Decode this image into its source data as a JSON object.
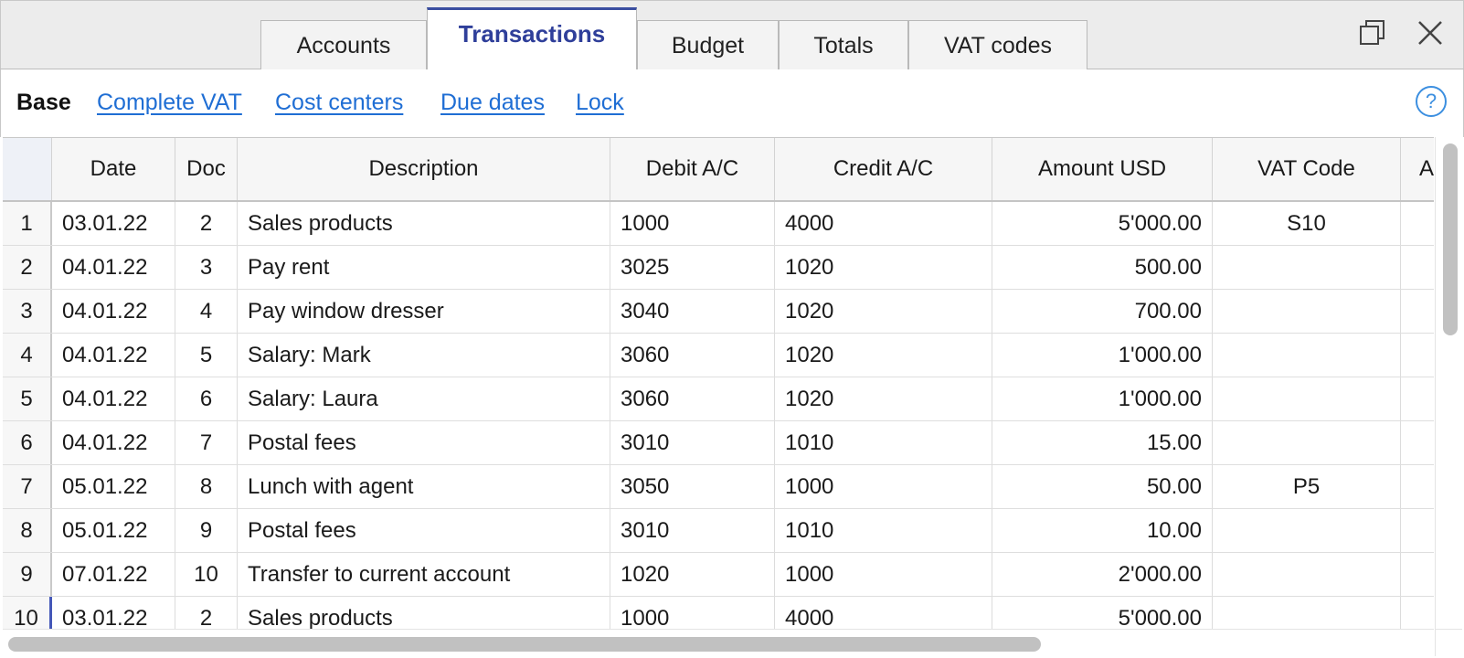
{
  "tabs": [
    {
      "label": "Accounts",
      "active": false
    },
    {
      "label": "Transactions",
      "active": true
    },
    {
      "label": "Budget",
      "active": false
    },
    {
      "label": "Totals",
      "active": false
    },
    {
      "label": "VAT codes",
      "active": false
    }
  ],
  "window_controls": {
    "restore_icon": "restore-window-icon",
    "close_icon": "close-icon"
  },
  "views": {
    "base": "Base",
    "links": [
      "Complete VAT",
      "Cost centers",
      "Due dates",
      "Lock"
    ],
    "help_symbol": "?"
  },
  "table": {
    "columns": [
      "",
      "Date",
      "Doc",
      "Description",
      "Debit A/C",
      "Credit A/C",
      "Amount USD",
      "VAT Code",
      "A"
    ],
    "rows": [
      {
        "num": "1",
        "date": "03.01.22",
        "doc": "2",
        "description": "Sales products",
        "debit": "1000",
        "credit": "4000",
        "amount": "5'000.00",
        "vat": "S10"
      },
      {
        "num": "2",
        "date": "04.01.22",
        "doc": "3",
        "description": "Pay rent",
        "debit": "3025",
        "credit": "1020",
        "amount": "500.00",
        "vat": ""
      },
      {
        "num": "3",
        "date": "04.01.22",
        "doc": "4",
        "description": "Pay window dresser",
        "debit": "3040",
        "credit": "1020",
        "amount": "700.00",
        "vat": ""
      },
      {
        "num": "4",
        "date": "04.01.22",
        "doc": "5",
        "description": "Salary: Mark",
        "debit": "3060",
        "credit": "1020",
        "amount": "1'000.00",
        "vat": ""
      },
      {
        "num": "5",
        "date": "04.01.22",
        "doc": "6",
        "description": "Salary: Laura",
        "debit": "3060",
        "credit": "1020",
        "amount": "1'000.00",
        "vat": ""
      },
      {
        "num": "6",
        "date": "04.01.22",
        "doc": "7",
        "description": "Postal fees",
        "debit": "3010",
        "credit": "1010",
        "amount": "15.00",
        "vat": ""
      },
      {
        "num": "7",
        "date": "05.01.22",
        "doc": "8",
        "description": "Lunch with agent",
        "debit": "3050",
        "credit": "1000",
        "amount": "50.00",
        "vat": "P5"
      },
      {
        "num": "8",
        "date": "05.01.22",
        "doc": "9",
        "description": "Postal fees",
        "debit": "3010",
        "credit": "1010",
        "amount": "10.00",
        "vat": ""
      },
      {
        "num": "9",
        "date": "07.01.22",
        "doc": "10",
        "description": "Transfer to current account",
        "debit": "1020",
        "credit": "1000",
        "amount": "2'000.00",
        "vat": ""
      },
      {
        "num": "10",
        "date": "03.01.22",
        "doc": "2",
        "description": "Sales products",
        "debit": "1000",
        "credit": "4000",
        "amount": "5'000.00",
        "vat": ""
      }
    ]
  },
  "colors": {
    "accent": "#3a4ea0",
    "link": "#1f6ed4",
    "help": "#3c8fe0"
  }
}
